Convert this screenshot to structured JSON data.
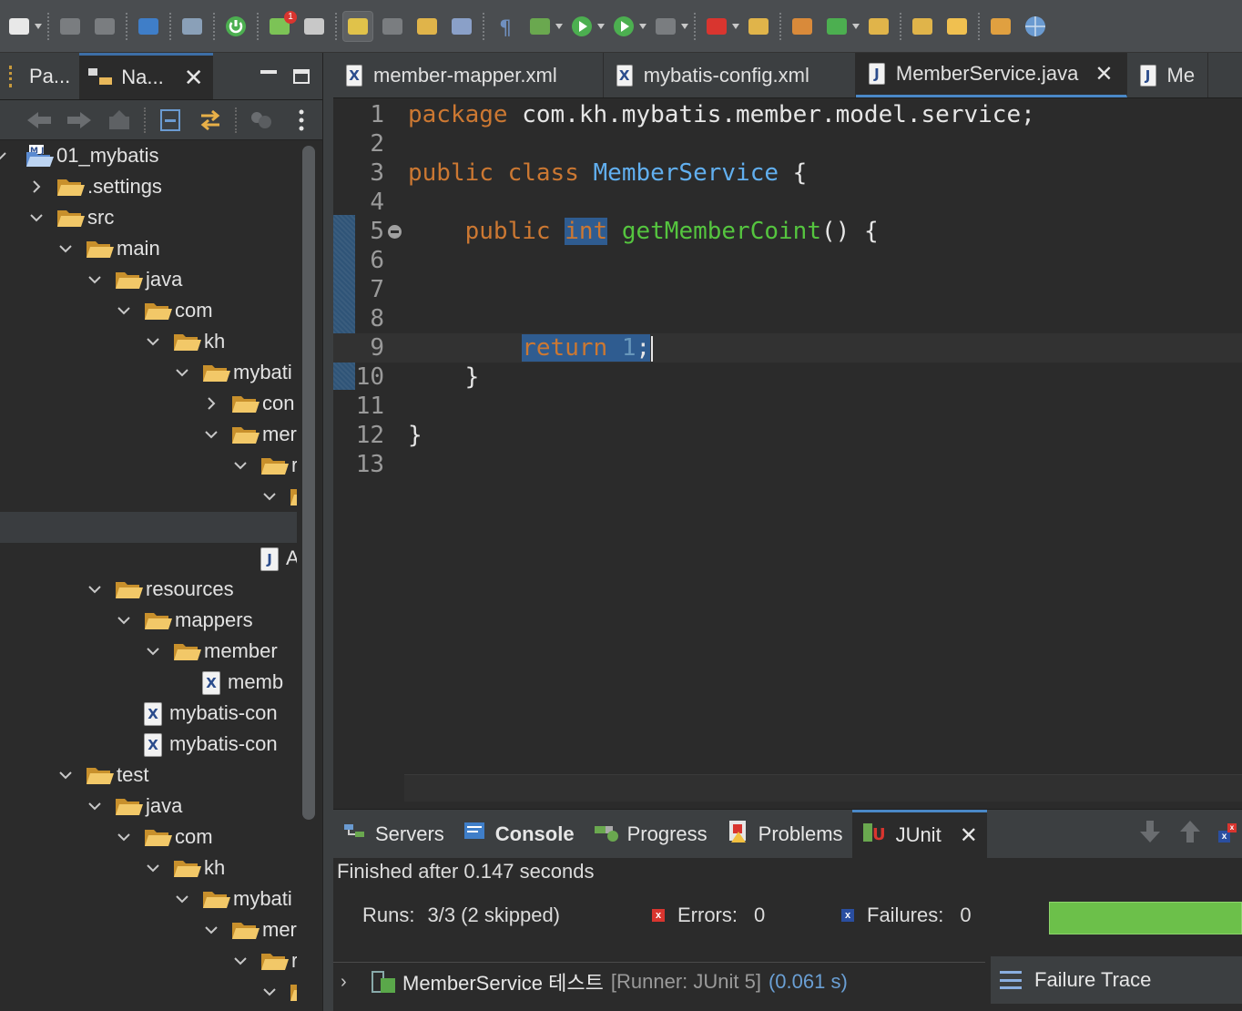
{
  "toolbar": {
    "icons": [
      "new-icon",
      "save-icon",
      "save-all-icon",
      "terminal-icon",
      "search-icon",
      "power-icon",
      "update-icon",
      "git-icon",
      "highlight-icon",
      "group-icon",
      "import-icon",
      "layout-icon",
      "pilcrow-icon",
      "debug-icon",
      "run-icon",
      "run-config-icon",
      "stop-icon",
      "external-tools-icon",
      "new-package-icon",
      "components-icon",
      "new-class-icon",
      "open-type-icon",
      "open-folder-icon",
      "pen-icon",
      "folder-open-icon",
      "globe-icon"
    ],
    "badge_count": "1"
  },
  "left_panel": {
    "tabs": [
      {
        "label": "Pa...",
        "active": false
      },
      {
        "label": "Na...",
        "active": true
      }
    ],
    "tree": [
      {
        "label": "01_mybatis",
        "depth": 0,
        "expanded": true,
        "icon": "project"
      },
      {
        "label": ".settings",
        "depth": 1,
        "expanded": false,
        "icon": "folder"
      },
      {
        "label": "src",
        "depth": 1,
        "expanded": true,
        "icon": "folder"
      },
      {
        "label": "main",
        "depth": 2,
        "expanded": true,
        "icon": "folder"
      },
      {
        "label": "java",
        "depth": 3,
        "expanded": true,
        "icon": "folder"
      },
      {
        "label": "com",
        "depth": 4,
        "expanded": true,
        "icon": "folder"
      },
      {
        "label": "kh",
        "depth": 5,
        "expanded": true,
        "icon": "folder"
      },
      {
        "label": "mybati",
        "depth": 6,
        "expanded": true,
        "icon": "folder"
      },
      {
        "label": "con",
        "depth": 7,
        "expanded": false,
        "icon": "folder"
      },
      {
        "label": "mer",
        "depth": 7,
        "expanded": true,
        "icon": "folder"
      },
      {
        "label": "r",
        "depth": 8,
        "expanded": true,
        "icon": "folder"
      },
      {
        "label": "",
        "depth": 9,
        "expanded": true,
        "icon": "folder"
      },
      {
        "label": "",
        "depth": 10,
        "expanded": null,
        "icon": "none",
        "selected": true
      },
      {
        "label": "App",
        "depth": 8,
        "expanded": null,
        "icon": "java"
      },
      {
        "label": "resources",
        "depth": 3,
        "expanded": true,
        "icon": "folder"
      },
      {
        "label": "mappers",
        "depth": 4,
        "expanded": true,
        "icon": "folder"
      },
      {
        "label": "member",
        "depth": 5,
        "expanded": true,
        "icon": "folder"
      },
      {
        "label": "memb",
        "depth": 6,
        "expanded": null,
        "icon": "xml"
      },
      {
        "label": "mybatis-con",
        "depth": 4,
        "expanded": null,
        "icon": "xml"
      },
      {
        "label": "mybatis-con",
        "depth": 4,
        "expanded": null,
        "icon": "xml"
      },
      {
        "label": "test",
        "depth": 2,
        "expanded": true,
        "icon": "folder"
      },
      {
        "label": "java",
        "depth": 3,
        "expanded": true,
        "icon": "folder"
      },
      {
        "label": "com",
        "depth": 4,
        "expanded": true,
        "icon": "folder"
      },
      {
        "label": "kh",
        "depth": 5,
        "expanded": true,
        "icon": "folder"
      },
      {
        "label": "mybati",
        "depth": 6,
        "expanded": true,
        "icon": "folder"
      },
      {
        "label": "mer",
        "depth": 7,
        "expanded": true,
        "icon": "folder"
      },
      {
        "label": "r",
        "depth": 8,
        "expanded": true,
        "icon": "folder"
      },
      {
        "label": "",
        "depth": 9,
        "expanded": true,
        "icon": "folder"
      }
    ]
  },
  "editor": {
    "tabs": [
      {
        "label": "member-mapper.xml",
        "icon": "X",
        "active": false
      },
      {
        "label": "mybatis-config.xml",
        "icon": "X",
        "active": false
      },
      {
        "label": "MemberService.java",
        "icon": "J",
        "active": true
      },
      {
        "label": "Me",
        "icon": "J",
        "active": false
      }
    ],
    "lines": [
      {
        "n": "1",
        "tokens": [
          [
            "kw",
            "package"
          ],
          [
            "txt",
            " com.kh.mybatis.member.model.service;"
          ]
        ]
      },
      {
        "n": "2",
        "tokens": []
      },
      {
        "n": "3",
        "tokens": [
          [
            "kw",
            "public"
          ],
          [
            "txt",
            " "
          ],
          [
            "kw",
            "class"
          ],
          [
            "txt",
            " "
          ],
          [
            "cls",
            "MemberService"
          ],
          [
            "txt",
            " {"
          ]
        ]
      },
      {
        "n": "4",
        "tokens": []
      },
      {
        "n": "5",
        "tokens": [
          [
            "txt",
            "    "
          ],
          [
            "kw",
            "public"
          ],
          [
            "txt",
            " "
          ],
          [
            "kwsel",
            "int"
          ],
          [
            "txt",
            " "
          ],
          [
            "mth",
            "getMemberCoint"
          ],
          [
            "txt",
            "() {"
          ]
        ],
        "fold": true
      },
      {
        "n": "6",
        "tokens": []
      },
      {
        "n": "7",
        "tokens": []
      },
      {
        "n": "8",
        "tokens": []
      },
      {
        "n": "9",
        "tokens": [
          [
            "txt",
            "        "
          ],
          [
            "kwsel",
            "return"
          ],
          [
            "sel",
            " "
          ],
          [
            "numsel",
            "1"
          ],
          [
            "sel",
            ";"
          ],
          [
            "caret",
            ""
          ]
        ],
        "current": true
      },
      {
        "n": "10",
        "tokens": [
          [
            "txt",
            "    }"
          ]
        ]
      },
      {
        "n": "11",
        "tokens": []
      },
      {
        "n": "12",
        "tokens": [
          [
            "txt",
            "}"
          ]
        ]
      },
      {
        "n": "13",
        "tokens": []
      }
    ]
  },
  "bottom_panel": {
    "tabs": [
      {
        "label": "Servers",
        "icon": "servers-icon",
        "bold": false,
        "active": false
      },
      {
        "label": "Console",
        "icon": "console-icon",
        "bold": true,
        "active": false
      },
      {
        "label": "Progress",
        "icon": "progress-icon",
        "bold": false,
        "active": false
      },
      {
        "label": "Problems",
        "icon": "problems-icon",
        "bold": false,
        "active": false
      },
      {
        "label": "JUnit",
        "icon": "junit-icon",
        "bold": false,
        "active": true
      }
    ],
    "junit": {
      "finished": "Finished after 0.147 seconds",
      "runs_label": "Runs:",
      "runs_value": "3/3 (2 skipped)",
      "errors_label": "Errors:",
      "errors_value": "0",
      "failures_label": "Failures:",
      "failures_value": "0",
      "bar_color": "#6cc04a",
      "result_name": "MemberService 테스트",
      "result_runner": "[Runner: JUnit 5]",
      "result_time": "(0.061 s)",
      "failure_trace_label": "Failure Trace"
    }
  },
  "colors": {
    "keyword": "#cc7832",
    "class": "#61afef",
    "method": "#55c53f",
    "number": "#6897bb",
    "selection": "#2f5c90",
    "tab_accent": "#4a88c7"
  }
}
